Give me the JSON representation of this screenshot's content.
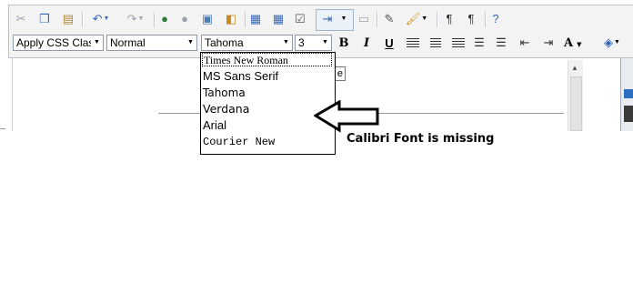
{
  "format_bar": {
    "css_class_select": "Apply CSS Class",
    "paragraph_style_select": "Normal",
    "font_name_select": "Tahoma",
    "font_size_select": "3",
    "bold_label": "B",
    "italic_label": "I",
    "underline_label": "U",
    "font_color_label": "A"
  },
  "font_dropdown": {
    "items": [
      {
        "label": "Times New Roman",
        "font": "serif"
      },
      {
        "label": "MS Sans Serif",
        "font": "sans"
      },
      {
        "label": "Tahoma",
        "font": "sans"
      },
      {
        "label": "Verdana",
        "font": "verdana"
      },
      {
        "label": "Arial",
        "font": "sans"
      },
      {
        "label": "Courier New",
        "font": "mono"
      }
    ]
  },
  "tooltip_fragment": "e",
  "annotation": {
    "text": "Calibri Font is missing"
  }
}
